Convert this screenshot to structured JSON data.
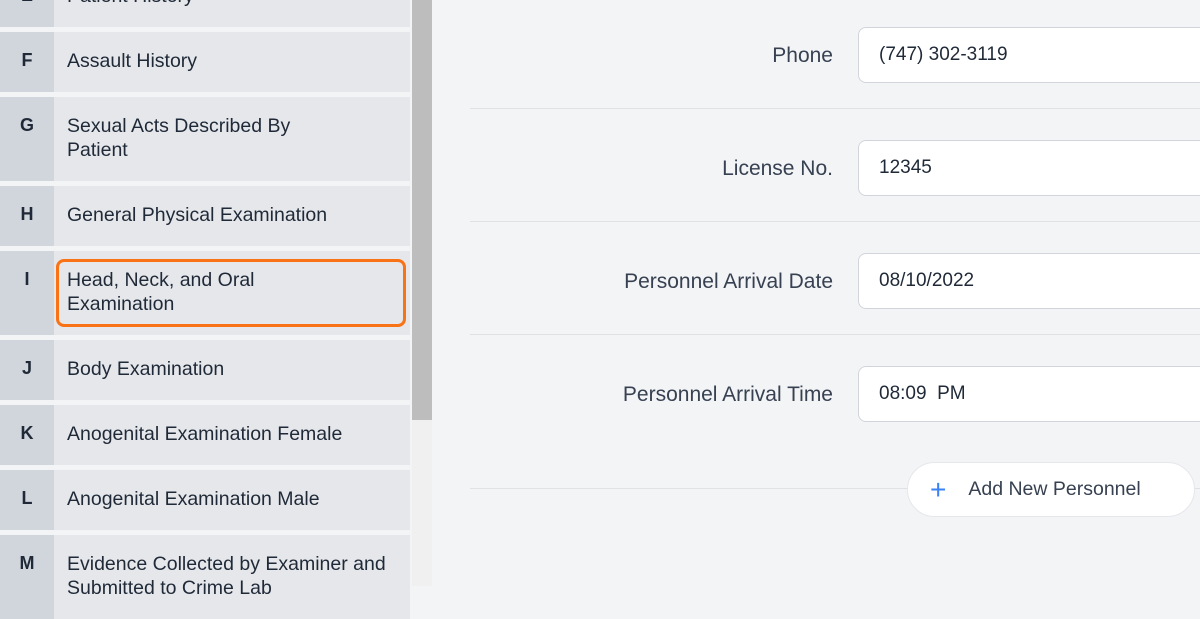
{
  "sidebar": {
    "items": [
      {
        "letter": "E",
        "label": "Patient History"
      },
      {
        "letter": "F",
        "label": "Assault History"
      },
      {
        "letter": "G",
        "label": "Sexual Acts Described By Patient"
      },
      {
        "letter": "H",
        "label": "General Physical Examination"
      },
      {
        "letter": "I",
        "label": "Head, Neck, and Oral Examination",
        "active": true
      },
      {
        "letter": "J",
        "label": "Body Examination"
      },
      {
        "letter": "K",
        "label": "Anogenital Examination Female"
      },
      {
        "letter": "L",
        "label": "Anogenital Examination Male"
      },
      {
        "letter": "M",
        "label": "Evidence Collected by Examiner and Submitted to Crime Lab"
      }
    ]
  },
  "form": {
    "phone": {
      "label": "Phone",
      "value": "(747) 302-3119"
    },
    "license": {
      "label": "License No.",
      "value": "12345"
    },
    "arrival_date": {
      "label": "Personnel Arrival Date",
      "value": "08/10/2022"
    },
    "arrival_time": {
      "label": "Personnel Arrival Time",
      "value": "08:09  PM"
    },
    "add_button": "Add New Personnel",
    "add_icon": "plus-icon"
  },
  "colors": {
    "active_outline": "#f97316",
    "accent": "#3b82f6"
  }
}
